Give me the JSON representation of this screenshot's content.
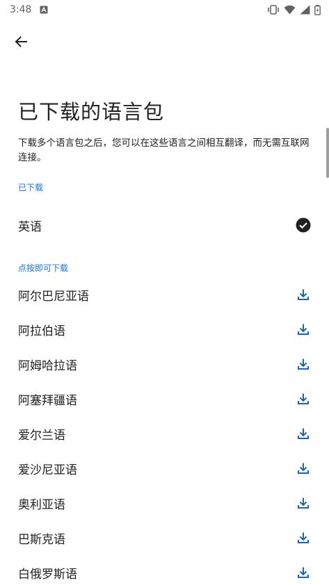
{
  "status_bar": {
    "time": "3:48"
  },
  "title": "已下载的语言包",
  "description": "下载多个语言包之后，您可以在这些语言之间相互翻译，而无需互联网连接。",
  "downloaded_section": {
    "label": "已下载",
    "items": [
      {
        "label": "英语",
        "icon": "check-circle-icon"
      }
    ]
  },
  "available_section": {
    "label": "点按即可下载",
    "items": [
      {
        "label": "阿尔巴尼亚语",
        "icon": "download-icon"
      },
      {
        "label": "阿拉伯语",
        "icon": "download-icon"
      },
      {
        "label": "阿姆哈拉语",
        "icon": "download-icon"
      },
      {
        "label": "阿塞拜疆语",
        "icon": "download-icon"
      },
      {
        "label": "爱尔兰语",
        "icon": "download-icon"
      },
      {
        "label": "爱沙尼亚语",
        "icon": "download-icon"
      },
      {
        "label": "奥利亚语",
        "icon": "download-icon"
      },
      {
        "label": "巴斯克语",
        "icon": "download-icon"
      },
      {
        "label": "白俄罗斯语",
        "icon": "download-icon"
      }
    ]
  },
  "colors": {
    "accent": "#1a73e8",
    "text": "#202124",
    "icon": "#1565c0"
  }
}
